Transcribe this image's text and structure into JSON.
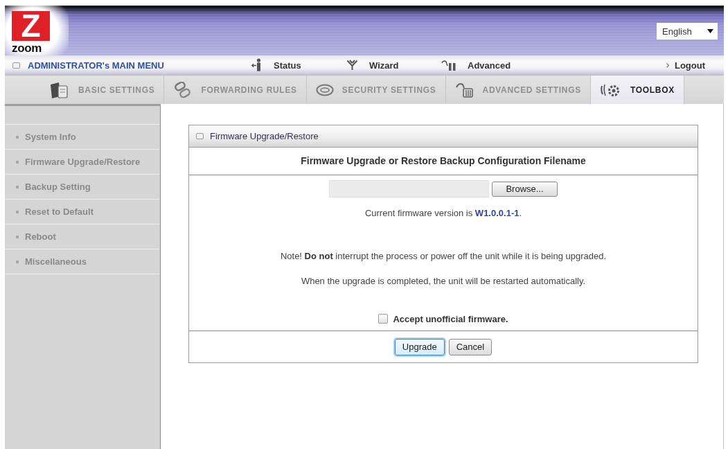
{
  "header": {
    "logo": {
      "mark": "Z",
      "wordmark": "zoom"
    },
    "language": "English"
  },
  "main_menu": {
    "title": "ADMINISTRATOR's MAIN MENU",
    "links": [
      {
        "label": "Status",
        "kind": "status"
      },
      {
        "label": "Wizard",
        "kind": "wizard"
      },
      {
        "label": "Advanced",
        "kind": "advanced"
      }
    ],
    "logout": "Logout"
  },
  "tabs": [
    {
      "label": "BASIC SETTINGS",
      "kind": "basic",
      "selected": false
    },
    {
      "label": "FORWARDING RULES",
      "kind": "forwarding",
      "selected": false
    },
    {
      "label": "SECURITY SETTINGS",
      "kind": "security",
      "selected": false
    },
    {
      "label": "ADVANCED SETTINGS",
      "kind": "advanced",
      "selected": false
    },
    {
      "label": "TOOLBOX",
      "kind": "toolbox",
      "selected": true
    }
  ],
  "sidebar": {
    "items": [
      {
        "label": "System Info"
      },
      {
        "label": "Firmware Upgrade/Restore"
      },
      {
        "label": "Backup Setting"
      },
      {
        "label": "Reset to Default"
      },
      {
        "label": "Reboot"
      },
      {
        "label": "Miscellaneous"
      }
    ]
  },
  "panel": {
    "title": "Firmware Upgrade/Restore",
    "subtitle": "Firmware Upgrade or Restore Backup Configuration Filename",
    "file_field": {
      "button": "Browse..."
    },
    "version_text": "Current firmware version is **W1.0.0.1-1**.",
    "notes": [
      "Note! **Do not** interrupt the process or power off the unit while it is being upgraded.",
      "When the upgrade is completed, the unit will be restarted automatically."
    ],
    "accept_unofficial": {
      "label": "Accept unofficial firmware.",
      "checked": false
    },
    "buttons": [
      {
        "label": "Upgrade",
        "focused": true
      },
      {
        "label": "Cancel",
        "focused": false
      }
    ]
  }
}
